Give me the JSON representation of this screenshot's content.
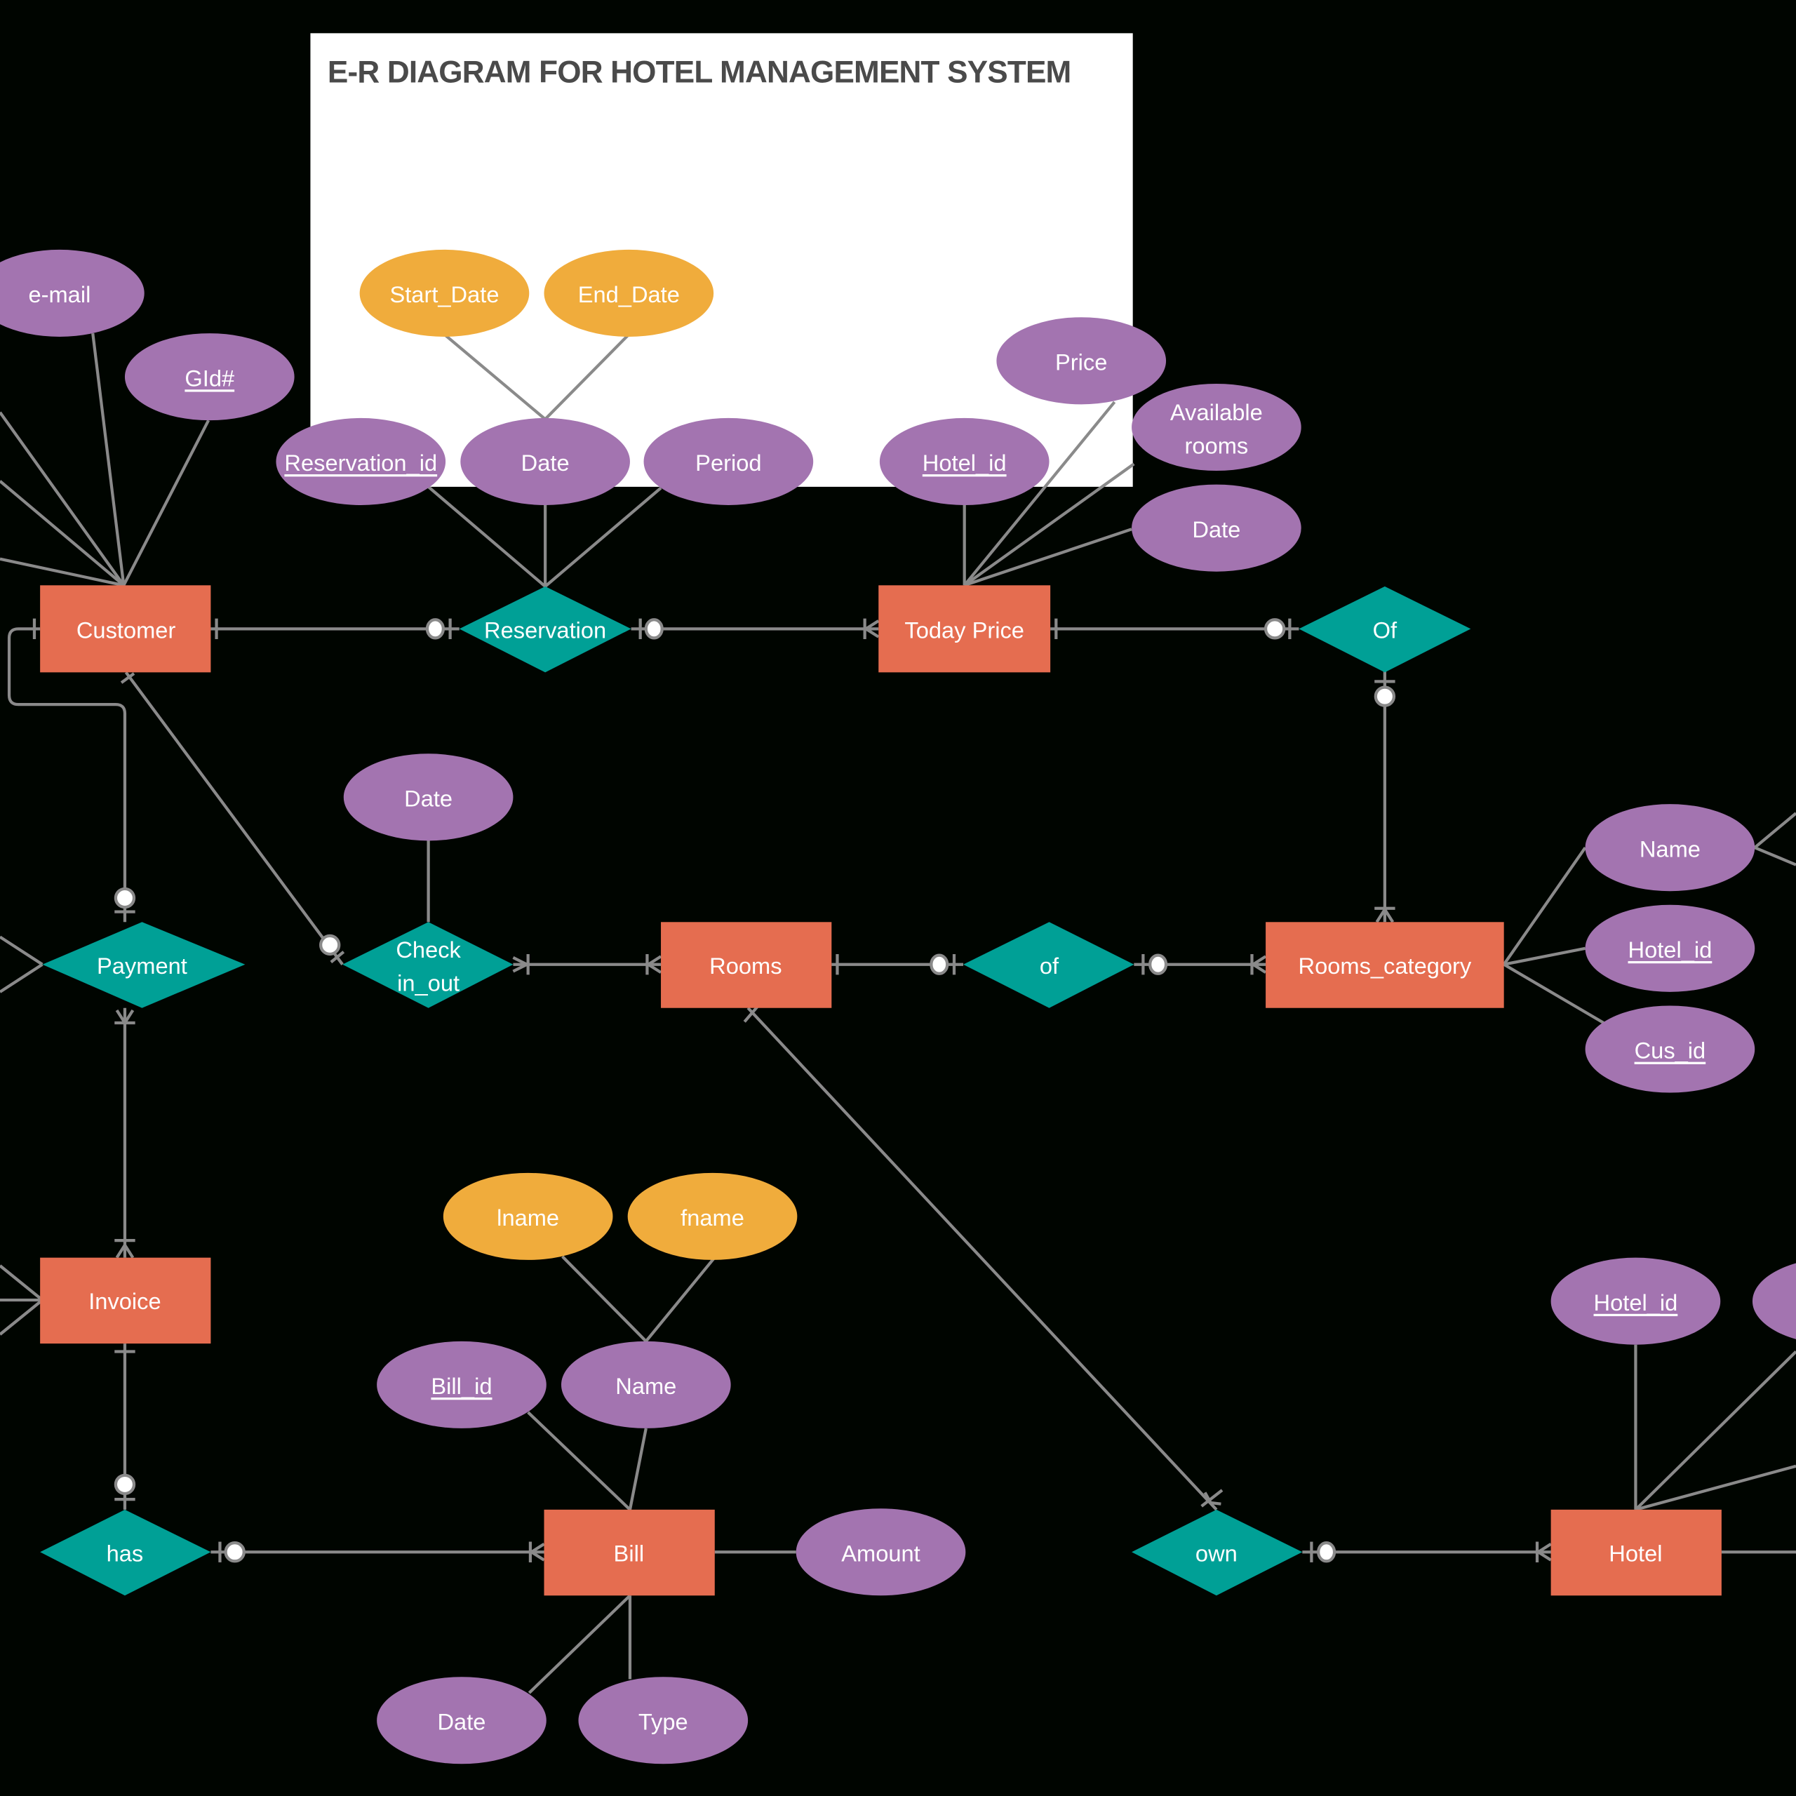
{
  "title": "E-R DIAGRAM FOR HOTEL MANAGEMENT SYSTEM",
  "colors": {
    "background": "#000500",
    "title_panel": "#ffffff",
    "title_text": "#4a4a4a",
    "entity": "#e56d50",
    "relationship": "#00a096",
    "attribute": "#a374b0",
    "composite_attribute": "#f0ac3c",
    "connector": "#8a8a8a",
    "label_text": "#ffffff"
  },
  "entities": [
    {
      "id": "customer",
      "label": "Customer"
    },
    {
      "id": "today_price",
      "label": "Today Price"
    },
    {
      "id": "rooms",
      "label": "Rooms"
    },
    {
      "id": "rooms_category",
      "label": "Rooms_category"
    },
    {
      "id": "invoice",
      "label": "Invoice"
    },
    {
      "id": "bill",
      "label": "Bill"
    },
    {
      "id": "hotel",
      "label": "Hotel"
    }
  ],
  "relationships": [
    {
      "id": "reservation",
      "label": "Reservation"
    },
    {
      "id": "of_upper",
      "label": "Of"
    },
    {
      "id": "payment",
      "label": "Payment"
    },
    {
      "id": "check_in_out",
      "label": "Check in_out",
      "lines": [
        "Check",
        "in_out"
      ]
    },
    {
      "id": "of_lower",
      "label": "of"
    },
    {
      "id": "has",
      "label": "has"
    },
    {
      "id": "own",
      "label": "own"
    }
  ],
  "attributes": [
    {
      "id": "cust_email",
      "label": "e-mail",
      "key": false,
      "owner": "customer"
    },
    {
      "id": "cust_gid",
      "label": "GId#",
      "key": true,
      "owner": "customer"
    },
    {
      "id": "res_id",
      "label": "Reservation_id",
      "key": true,
      "owner": "reservation"
    },
    {
      "id": "res_date",
      "label": "Date",
      "key": false,
      "owner": "reservation"
    },
    {
      "id": "res_start",
      "label": "Start_Date",
      "key": false,
      "composite_part": true,
      "owner": "res_date"
    },
    {
      "id": "res_end",
      "label": "End_Date",
      "key": false,
      "composite_part": true,
      "owner": "res_date"
    },
    {
      "id": "res_period",
      "label": "Period",
      "key": false,
      "owner": "reservation"
    },
    {
      "id": "tp_hotel_id",
      "label": "Hotel_id",
      "key": true,
      "owner": "today_price"
    },
    {
      "id": "tp_price",
      "label": "Price",
      "key": false,
      "owner": "today_price"
    },
    {
      "id": "tp_avail",
      "label": "Available rooms",
      "lines": [
        "Available",
        "rooms"
      ],
      "key": false,
      "owner": "today_price"
    },
    {
      "id": "tp_date",
      "label": "Date",
      "key": false,
      "owner": "today_price"
    },
    {
      "id": "cio_date",
      "label": "Date",
      "key": false,
      "owner": "check_in_out"
    },
    {
      "id": "rc_name",
      "label": "Name",
      "key": false,
      "owner": "rooms_category"
    },
    {
      "id": "rc_hotel_id",
      "label": "Hotel_id",
      "key": true,
      "owner": "rooms_category"
    },
    {
      "id": "rc_cus_id",
      "label": "Cus_id",
      "key": true,
      "owner": "rooms_category"
    },
    {
      "id": "bill_lname",
      "label": "lname",
      "key": false,
      "composite_part": true,
      "owner": "bill_name"
    },
    {
      "id": "bill_fname",
      "label": "fname",
      "key": false,
      "composite_part": true,
      "owner": "bill_name"
    },
    {
      "id": "bill_id",
      "label": "Bill_id",
      "key": true,
      "owner": "bill"
    },
    {
      "id": "bill_name",
      "label": "Name",
      "key": false,
      "owner": "bill"
    },
    {
      "id": "bill_amount",
      "label": "Amount",
      "key": false,
      "owner": "bill"
    },
    {
      "id": "bill_date",
      "label": "Date",
      "key": false,
      "owner": "bill"
    },
    {
      "id": "bill_type",
      "label": "Type",
      "key": false,
      "owner": "bill"
    },
    {
      "id": "hotel_id",
      "label": "Hotel_id",
      "key": true,
      "owner": "hotel"
    },
    {
      "id": "hotel_attr2",
      "label": "",
      "key": false,
      "owner": "hotel"
    }
  ]
}
